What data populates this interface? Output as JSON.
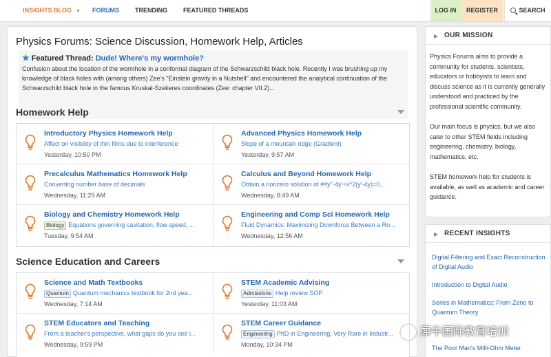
{
  "nav": {
    "blog": "INSIGHTS BLOG",
    "forums": "FORUMS",
    "trending": "TRENDING",
    "featured_threads": "FEATURED THREADS",
    "login": "LOG IN",
    "register": "REGISTER",
    "search": "SEARCH"
  },
  "main": {
    "title": "Physics Forums: Science Discussion, Homework Help, Articles",
    "featured": {
      "label": "Featured Thread:",
      "link": "Dude! Where's my wormhole?",
      "desc": "Confusion about the location of the wormhole in a conformal diagram of the Schwarzschild black hole. Recently I was brushing up my knowledge of black holes with (among others) Zee's \"Einstein gravity in a Nutshell\" and encountered the analytical continuation of the Schwarzschild black hole in the famous Kruskal-Szekeres coordinates (Zee: chapter VII.2)..."
    },
    "sections": [
      {
        "title": "Homework Help",
        "forums": [
          {
            "title": "Introductory Physics Homework Help",
            "tag": "",
            "sub": "Affect on visibility of thin films due to interference",
            "date": "Yesterday, 10:50 PM"
          },
          {
            "title": "Advanced Physics Homework Help",
            "tag": "",
            "sub": "Slope of a mountain ridge (Gradient)",
            "date": "Yesterday, 9:57 AM"
          },
          {
            "title": "Precalculus Mathematics Homework Help",
            "tag": "",
            "sub": "Converting number base of decimals",
            "date": "Wednesday, 11:29 AM"
          },
          {
            "title": "Calculus and Beyond Homework Help",
            "tag": "",
            "sub": "Obtain a nonzero solution of ##y''-4y'+x^2(y'-4y)=0...",
            "date": "Wednesday, 8:49 AM"
          },
          {
            "title": "Biology and Chemistry Homework Help",
            "tag": "Biology",
            "sub": "Equations governing cavitation, flow speed, ...",
            "date": "Tuesday, 9:54 AM"
          },
          {
            "title": "Engineering and Comp Sci Homework Help",
            "tag": "",
            "sub": "Fluid Dynamics: Maximizing Downforce Between a Ro...",
            "date": "Wednesday, 12:56 AM"
          }
        ]
      },
      {
        "title": "Science Education and Careers",
        "forums": [
          {
            "title": "Science and Math Textbooks",
            "tag": "Quantum",
            "sub": "Quantum mechanics textbook for 2nd yea...",
            "date": "Wednesday, 7:14 AM"
          },
          {
            "title": "STEM Academic Advising",
            "tag": "Admissions",
            "sub": "Help review SOP",
            "date": "Yesterday, 11:03 AM"
          },
          {
            "title": "STEM Educators and Teaching",
            "tag": "",
            "sub": "From a teacher's perspective, what gaps do you see i...",
            "date": "Wednesday, 9:59 PM"
          },
          {
            "title": "STEM Career Guidance",
            "tag": "Engineering",
            "sub": "PhD in Engineering, Very Rare in Industr...",
            "date": "Monday, 10:34 PM"
          }
        ]
      }
    ]
  },
  "sidebar": {
    "mission": {
      "title": "OUR MISSION",
      "paragraphs": [
        "Physics Forums aims to provide a community for students, scientists, educators or hobbyists to learn and discuss science as it is currently generally understood and practiced by the professional scientific community.",
        "Our main focus is physics, but we also cater to other STEM fields including engineering, chemistry, biology, mathematics, etc.",
        "STEM homework help for students is available, as well as academic and career guidance."
      ]
    },
    "insights": {
      "title": "RECENT INSIGHTS",
      "items": [
        "Digital Filtering and Exact Reconstruction of Digital Audio",
        "Introduction to Digital Audio",
        "Series in Mathematics: From Zeno to Quantum Theory",
        "The Poor Man's Milli-Ohm Meter"
      ]
    }
  },
  "watermark": "犀牛国际教育培训",
  "colors": {
    "link": "#2566b0",
    "accent": "#e8792b",
    "bulb": "#e8792b",
    "login_bg": "#dcf0c8",
    "register_bg": "#fbe3c4"
  },
  "icons": {
    "featured": "star-icon",
    "forum": "lightbulb-icon",
    "search": "search-icon",
    "collapse": "caret-down-icon",
    "sidebar": "chevron-right-icon"
  }
}
